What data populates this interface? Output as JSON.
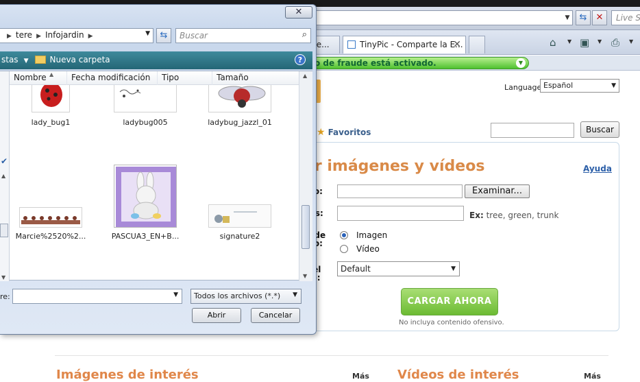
{
  "browser": {
    "live_search_placeholder": "Live S",
    "tabs": [
      {
        "label": "eee..."
      },
      {
        "label": "TinyPic - Comparte la E..."
      },
      {
        "label": ""
      }
    ],
    "phishing_message": "o de fraude está activado."
  },
  "page": {
    "language_label": "Language:",
    "language_value": "Español",
    "favoritos_label": "Favoritos",
    "search_button": "Buscar",
    "panel_title": "ar imágenes y vídeos",
    "help_link": "Ayuda",
    "file_label": "ivo:",
    "browse_button": "Examinar...",
    "tags_label": "tas:",
    "tags_hint_prefix": "Ex:",
    "tags_hint_text": "tree, green, trunk",
    "type_label_line1": "o de",
    "type_label_line2": "ivo:",
    "radio_image": "Imagen",
    "radio_video": "Vídeo",
    "size_label_line1": "r el",
    "size_label_line2": "ño:",
    "size_value": "Default",
    "upload_button": "CARGAR AHORA",
    "upload_note": "No incluya contenido ofensivo.",
    "section_images_title": "Imágenes de interés",
    "section_images_more": "Más",
    "section_videos_title": "Vídeos de interés",
    "section_videos_more": "Más"
  },
  "dialog": {
    "close_glyph": "✕",
    "breadcrumb": [
      "tere",
      "Infojardin"
    ],
    "search_placeholder": "Buscar",
    "organize_label": "stas",
    "new_folder_label": "Nueva carpeta",
    "columns": [
      "Nombre",
      "Fecha modificación",
      "Tipo",
      "Tamaño"
    ],
    "files": [
      {
        "name": "lady_bug1"
      },
      {
        "name": "ladybug005"
      },
      {
        "name": "ladybug_jazzl_01"
      },
      {
        "name": "Marcie%2520%2..."
      },
      {
        "name": "PASCUA3_EN+B..."
      },
      {
        "name": "signature2"
      }
    ],
    "filename_label": "re:",
    "filename_value": "",
    "filetype_value": "Todos los archivos (*.*)",
    "open_button": "Abrir",
    "cancel_button": "Cancelar"
  },
  "colors": {
    "accent_orange": "#d98a48",
    "upload_green": "#6cbb33",
    "toolbar_teal": "#246676",
    "link_blue": "#2c5fa8"
  }
}
